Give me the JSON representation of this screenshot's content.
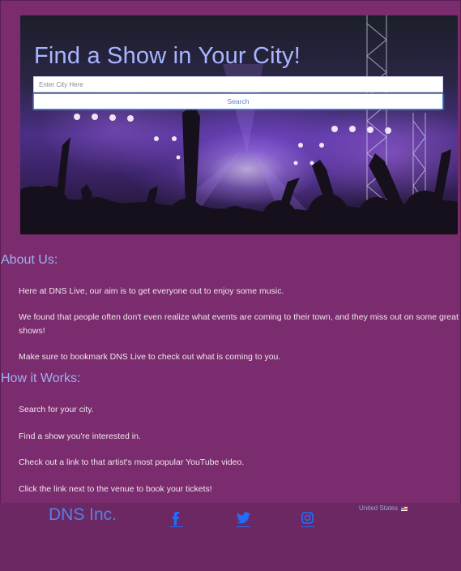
{
  "hero": {
    "title": "Find a Show in Your City!",
    "search_placeholder": "Enter City Here",
    "search_value": "",
    "search_button_label": "Search"
  },
  "about": {
    "heading": "About Us:",
    "paragraphs": [
      "Here at DNS Live, our aim is to get everyone out to enjoy some music.",
      "We found that people often don't even realize what events are coming to their town, and they miss out on some great shows!",
      "Make sure to bookmark DNS Live to check out what is coming to you."
    ]
  },
  "how": {
    "heading": "How it Works:",
    "steps": [
      "Search for your city.",
      "Find a show you're interested in.",
      "Check out a link to that artist's most popular YouTube video.",
      "Click the link next to the venue to book your tickets!"
    ]
  },
  "footer": {
    "brand": "DNS Inc.",
    "social": [
      "facebook-icon",
      "twitter-icon",
      "instagram-icon"
    ],
    "locale": "United States"
  },
  "colors": {
    "page_background": "#7a2c6e",
    "footer_background": "#6b2862",
    "heading": "#9fb0ee",
    "link": "#1f6fff"
  }
}
